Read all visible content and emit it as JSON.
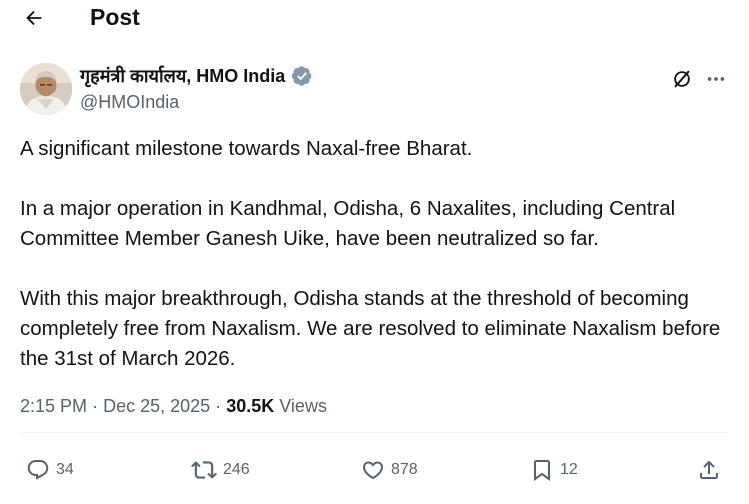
{
  "header": {
    "title": "Post",
    "back_icon": "arrow-left-icon"
  },
  "author": {
    "display_name": "गृहमंत्री कार्यालय, HMO India",
    "handle": "@HMOIndia",
    "verified_icon": "verified-badge-icon",
    "verified_color": "#829aab"
  },
  "tweet": {
    "paragraphs": [
      "A significant milestone towards Naxal-free Bharat.",
      "In a major operation in Kandhmal, Odisha, 6 Naxalites, including Central Committee Member Ganesh Uike, have been neutralized so far.",
      "With this major breakthrough, Odisha stands at the threshold of becoming completely free from Naxalism. We are resolved to eliminate Naxalism before the 31st of March 2026."
    ]
  },
  "meta": {
    "time": "2:15 PM",
    "separator": "·",
    "date": "Dec 25, 2025",
    "separator2": "·",
    "views_count": "30.5K",
    "views_label": "Views"
  },
  "actions": {
    "reply_count": "34",
    "repost_count": "246",
    "like_count": "878",
    "bookmark_count": "12"
  },
  "colors": {
    "text_primary": "#0f1419",
    "text_secondary": "#536471",
    "divider": "#eff3f4"
  }
}
